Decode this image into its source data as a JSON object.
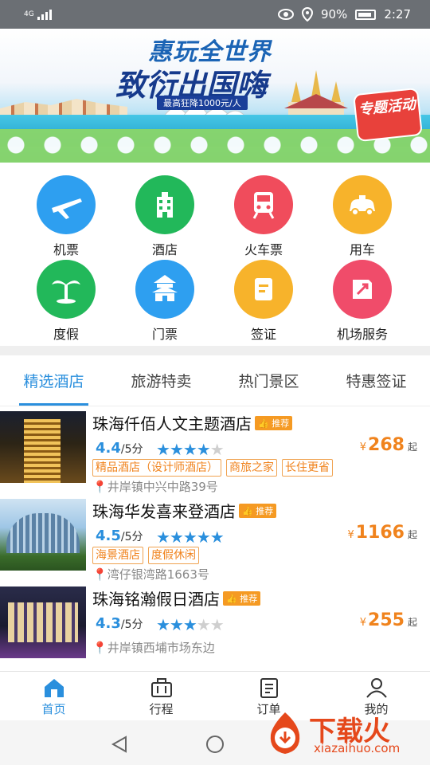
{
  "status_bar": {
    "network": "4G",
    "battery_percent": "90%",
    "time": "2:27",
    "icons": [
      "signal-icon",
      "eye-icon",
      "location-icon",
      "battery-icon"
    ]
  },
  "banner": {
    "headline_line1": "惠玩全世界",
    "headline_line2": "致衍出国嗨",
    "sub_text": "最高狂降1000元/人",
    "badge_text": "专题活动"
  },
  "services": [
    {
      "label": "机票",
      "icon": "airplane-icon",
      "color": "#2e9ff0"
    },
    {
      "label": "酒店",
      "icon": "hotel-building-icon",
      "color": "#22b85a"
    },
    {
      "label": "火车票",
      "icon": "train-icon",
      "color": "#f04c5c"
    },
    {
      "label": "用车",
      "icon": "car-icon",
      "color": "#f7b32b"
    },
    {
      "label": "度假",
      "icon": "palm-tree-icon",
      "color": "#22b85a"
    },
    {
      "label": "门票",
      "icon": "temple-icon",
      "color": "#2e9ff0"
    },
    {
      "label": "签证",
      "icon": "visa-doc-icon",
      "color": "#f7b32b"
    },
    {
      "label": "机场服务",
      "icon": "airport-service-icon",
      "color": "#f04c6a"
    }
  ],
  "tabs": [
    {
      "label": "精选酒店",
      "active": true
    },
    {
      "label": "旅游特卖",
      "active": false
    },
    {
      "label": "热门景区",
      "active": false
    },
    {
      "label": "特惠签证",
      "active": false
    }
  ],
  "hotels": [
    {
      "name": "珠海仟佰人文主题酒店",
      "badge": "推荐",
      "score": "4.4",
      "score_suffix": "/5分",
      "stars": 4,
      "price": "268",
      "currency": "¥",
      "price_suffix": "起",
      "tags": [
        "精品酒店（设计师酒店）",
        "商旅之家",
        "长住更省"
      ],
      "address": "井岸镇中兴中路39号"
    },
    {
      "name": "珠海华发喜来登酒店",
      "badge": "推荐",
      "score": "4.5",
      "score_suffix": "/5分",
      "stars": 5,
      "price": "1166",
      "currency": "¥",
      "price_suffix": "起",
      "tags": [
        "海景酒店",
        "度假休闲"
      ],
      "address": "湾仔银湾路1663号"
    },
    {
      "name": "珠海铭瀚假日酒店",
      "badge": "推荐",
      "score": "4.3",
      "score_suffix": "/5分",
      "stars": 3,
      "price": "255",
      "currency": "¥",
      "price_suffix": "起",
      "tags": [],
      "address": "井岸镇西埔市场东边"
    }
  ],
  "bottom_nav": [
    {
      "label": "首页",
      "icon": "home-icon",
      "active": true
    },
    {
      "label": "行程",
      "icon": "briefcase-icon",
      "active": false
    },
    {
      "label": "订单",
      "icon": "order-list-icon",
      "active": false
    },
    {
      "label": "我的",
      "icon": "person-icon",
      "active": false
    }
  ],
  "watermark": {
    "title": "下载火",
    "url": "xiazaihuo.com"
  }
}
